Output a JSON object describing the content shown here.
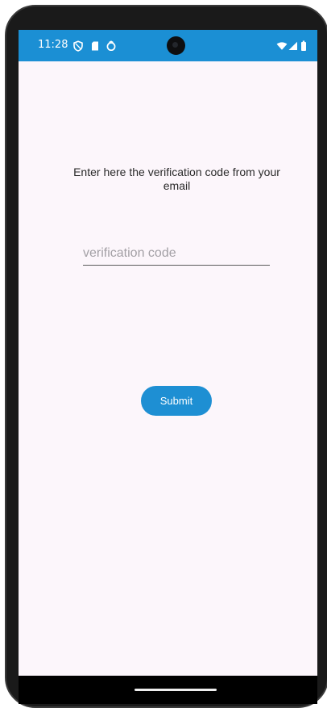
{
  "status_bar": {
    "time": "11:28",
    "background_color": "#1b8fd4",
    "left_icons": [
      "shield-icon",
      "sim-card-icon",
      "sync-icon"
    ],
    "right_icons": [
      "wifi-icon",
      "signal-icon",
      "battery-icon"
    ]
  },
  "verification": {
    "prompt": "Enter here the verification code from your email",
    "code_placeholder": "verification code",
    "code_value": "",
    "submit_label": "Submit",
    "accent_color": "#1e8fd3",
    "screen_background": "#fcf6fb"
  },
  "navigation_bar": {
    "gesture_handle": "home-gesture-handle"
  }
}
